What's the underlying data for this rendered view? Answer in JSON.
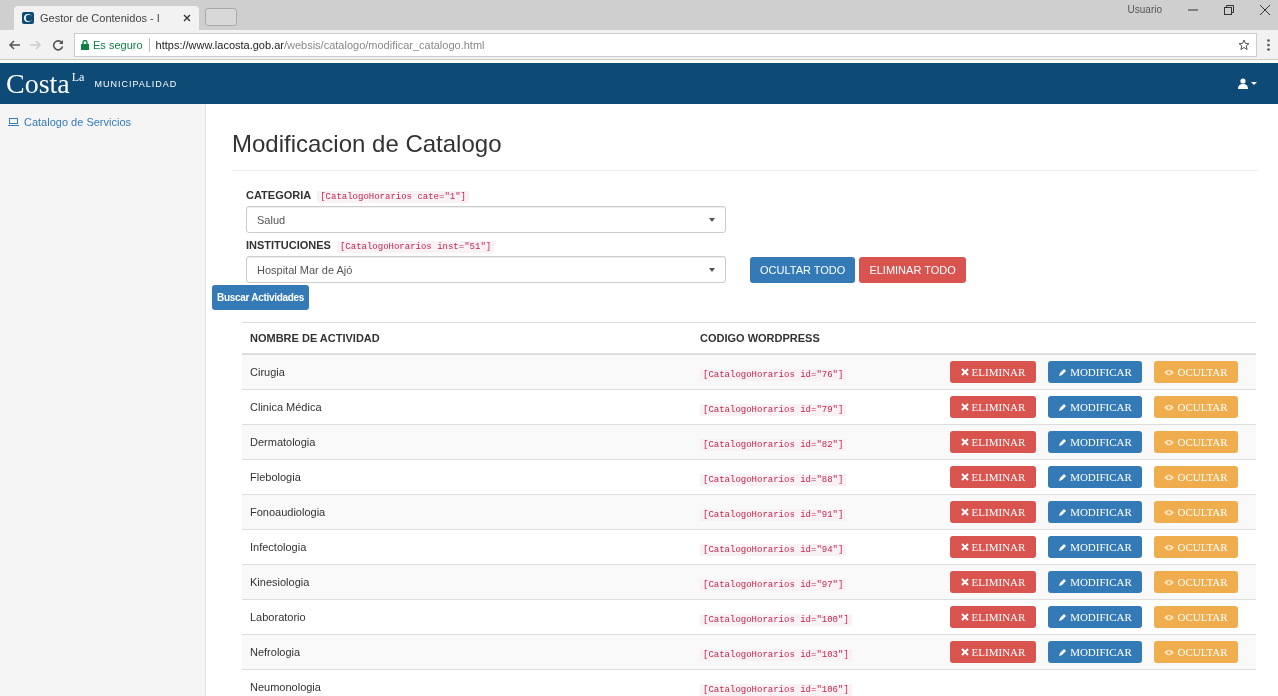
{
  "browser": {
    "tab_title": "Gestor de Contenidos - I",
    "user": "Usuario",
    "secure_label": "Es seguro",
    "url_host": "https://www.lacosta.gob.ar",
    "url_path": "/websis/catalogo/modificar_catalogo.html"
  },
  "navbar": {
    "logo_main": "Costa",
    "logo_small": "La",
    "logo_subtitle": "MUNICIPALIDAD"
  },
  "sidebar": {
    "items": [
      {
        "label": "Catalogo de Servicios",
        "selected": false
      }
    ]
  },
  "page_title": "Modificacion de Catalogo",
  "filters": [
    {
      "label": "CATEGORIA",
      "shortcode": "[CatalogoHorarios cate=\"1\"]",
      "value": "Salud"
    },
    {
      "label": "INSTITUCIONES",
      "shortcode": "[CatalogoHorarios inst=\"51\"]",
      "value": "Hospital Mar de Ajó"
    }
  ],
  "bulk_buttons": [
    {
      "label": "OCULTAR TODO",
      "kind": "primary"
    },
    {
      "label": "ELIMINAR TODO",
      "kind": "danger"
    }
  ],
  "search_button": "Buscar Actividades",
  "table": {
    "columns": [
      "NOMBRE DE ACTIVIDAD",
      "CODIGO WORDPRESS"
    ],
    "rows": [
      {
        "name": "Cirugia",
        "code": "[CatalogoHorarios id=\"76\"]",
        "actions": [
          {
            "label": "ELIMINAR",
            "kind": "danger"
          },
          {
            "label": "MODIFICAR",
            "kind": "primary"
          },
          {
            "label": "OCULTAR",
            "kind": "warning"
          }
        ]
      },
      {
        "name": "Clinica Médica",
        "code": "[CatalogoHorarios id=\"79\"]",
        "actions": [
          {
            "label": "ELIMINAR",
            "kind": "danger"
          },
          {
            "label": "MODIFICAR",
            "kind": "primary"
          },
          {
            "label": "OCULTAR",
            "kind": "warning"
          }
        ]
      },
      {
        "name": "Dermatologia",
        "code": "[CatalogoHorarios id=\"82\"]",
        "actions": [
          {
            "label": "ELIMINAR",
            "kind": "danger"
          },
          {
            "label": "MODIFICAR",
            "kind": "primary"
          },
          {
            "label": "OCULTAR",
            "kind": "warning"
          }
        ]
      },
      {
        "name": "Flebologia",
        "code": "[CatalogoHorarios id=\"88\"]",
        "actions": [
          {
            "label": "ELIMINAR",
            "kind": "danger"
          },
          {
            "label": "MODIFICAR",
            "kind": "primary"
          },
          {
            "label": "OCULTAR",
            "kind": "warning"
          }
        ]
      },
      {
        "name": "Fonoaudiologia",
        "code": "[CatalogoHorarios id=\"91\"]",
        "actions": [
          {
            "label": "ELIMINAR",
            "kind": "danger"
          },
          {
            "label": "MODIFICAR",
            "kind": "primary"
          },
          {
            "label": "OCULTAR",
            "kind": "warning"
          }
        ]
      },
      {
        "name": "Infectologia",
        "code": "[CatalogoHorarios id=\"94\"]",
        "actions": [
          {
            "label": "ELIMINAR",
            "kind": "danger"
          },
          {
            "label": "MODIFICAR",
            "kind": "primary"
          },
          {
            "label": "OCULTAR",
            "kind": "warning"
          }
        ]
      },
      {
        "name": "Kinesiologia",
        "code": "[CatalogoHorarios id=\"97\"]",
        "actions": [
          {
            "label": "ELIMINAR",
            "kind": "danger"
          },
          {
            "label": "MODIFICAR",
            "kind": "primary"
          },
          {
            "label": "OCULTAR",
            "kind": "warning"
          }
        ]
      },
      {
        "name": "Laboratorio",
        "code": "[CatalogoHorarios id=\"100\"]",
        "actions": [
          {
            "label": "ELIMINAR",
            "kind": "danger"
          },
          {
            "label": "MODIFICAR",
            "kind": "primary"
          },
          {
            "label": "OCULTAR",
            "kind": "warning"
          }
        ]
      },
      {
        "name": "Nefrologia",
        "code": "[CatalogoHorarios id=\"103\"]",
        "actions": [
          {
            "label": "ELIMINAR",
            "kind": "danger"
          },
          {
            "label": "MODIFICAR",
            "kind": "primary"
          },
          {
            "label": "OCULTAR",
            "kind": "warning"
          }
        ]
      },
      {
        "name": "Neumonologia",
        "code": "[CatalogoHorarios id=\"106\"]"
      }
    ]
  }
}
